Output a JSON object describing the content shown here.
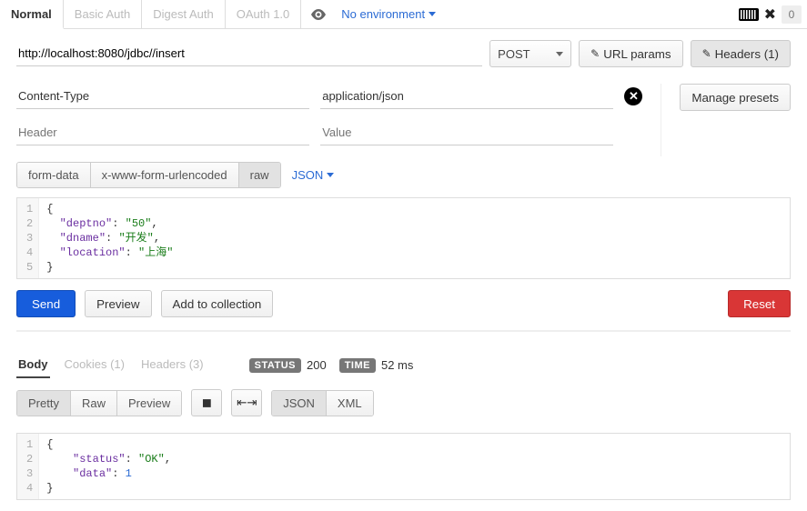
{
  "topbar": {
    "tabs": [
      "Normal",
      "Basic Auth",
      "Digest Auth",
      "OAuth 1.0"
    ],
    "active_tab": 0,
    "environment_label": "No environment",
    "counter": "0"
  },
  "request": {
    "url": "http://localhost:8080/jdbc//insert",
    "method": "POST",
    "url_params_label": "URL params",
    "headers_button_label": "Headers (1)",
    "headers": [
      {
        "key": "Content-Type",
        "value": "application/json"
      },
      {
        "key": "",
        "value": "",
        "key_ph": "Header",
        "value_ph": "Value"
      }
    ],
    "manage_presets_label": "Manage presets",
    "body_type_segments": [
      "form-data",
      "x-www-form-urlencoded",
      "raw"
    ],
    "body_type_selected": 2,
    "raw_type_label": "JSON",
    "body_lines": [
      "{",
      "  \"deptno\":\"50\",",
      "  \"dname\":\"开发\",",
      "  \"location\":\"上海\"",
      "}"
    ]
  },
  "actions": {
    "send": "Send",
    "preview": "Preview",
    "add_to_collection": "Add to collection",
    "reset": "Reset"
  },
  "response": {
    "tabs": {
      "body": "Body",
      "cookies": "Cookies (1)",
      "headers": "Headers (3)"
    },
    "active_tab": "body",
    "status_label": "STATUS",
    "status_code": "200",
    "time_label": "TIME",
    "time_value": "52 ms",
    "view_segments": [
      "Pretty",
      "Raw",
      "Preview"
    ],
    "view_selected": 0,
    "format_segments": [
      "JSON",
      "XML"
    ],
    "format_selected": 0,
    "body_lines": [
      "{",
      "    \"status\": \"OK\",",
      "    \"data\": 1",
      "}"
    ]
  }
}
